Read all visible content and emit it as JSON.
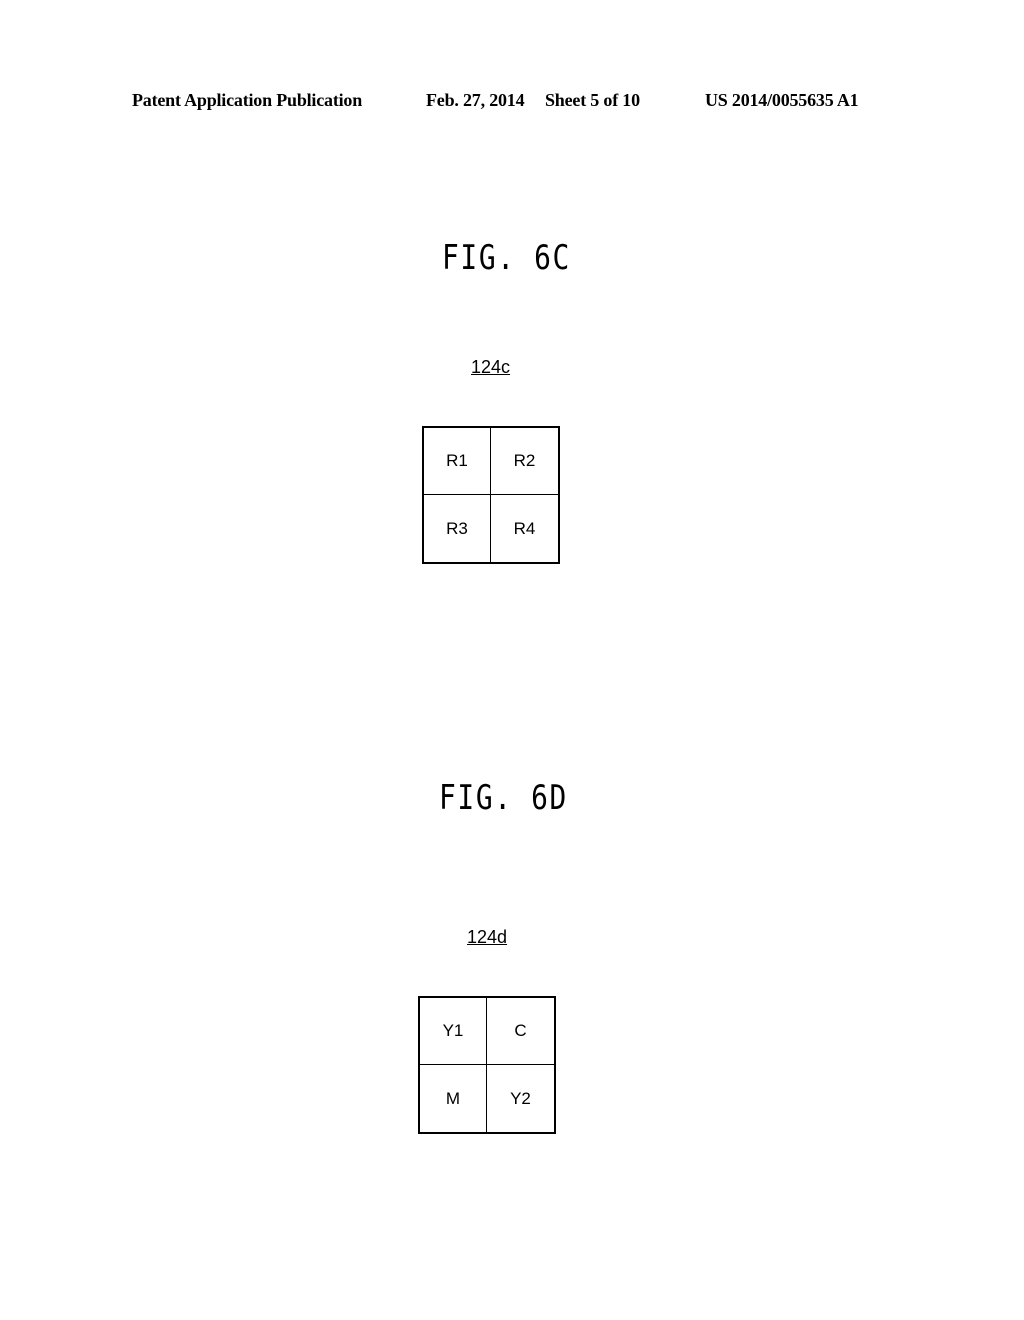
{
  "header": {
    "publication": "Patent Application Publication",
    "date": "Feb. 27, 2014",
    "sheet": "Sheet 5 of 10",
    "number": "US 2014/0055635 A1"
  },
  "figures": [
    {
      "title": "FIG. 6C",
      "reference": "124c",
      "cells": [
        "R1",
        "R2",
        "R3",
        "R4"
      ]
    },
    {
      "title": "FIG. 6D",
      "reference": "124d",
      "cells": [
        "Y1",
        "C",
        "M",
        "Y2"
      ]
    }
  ]
}
